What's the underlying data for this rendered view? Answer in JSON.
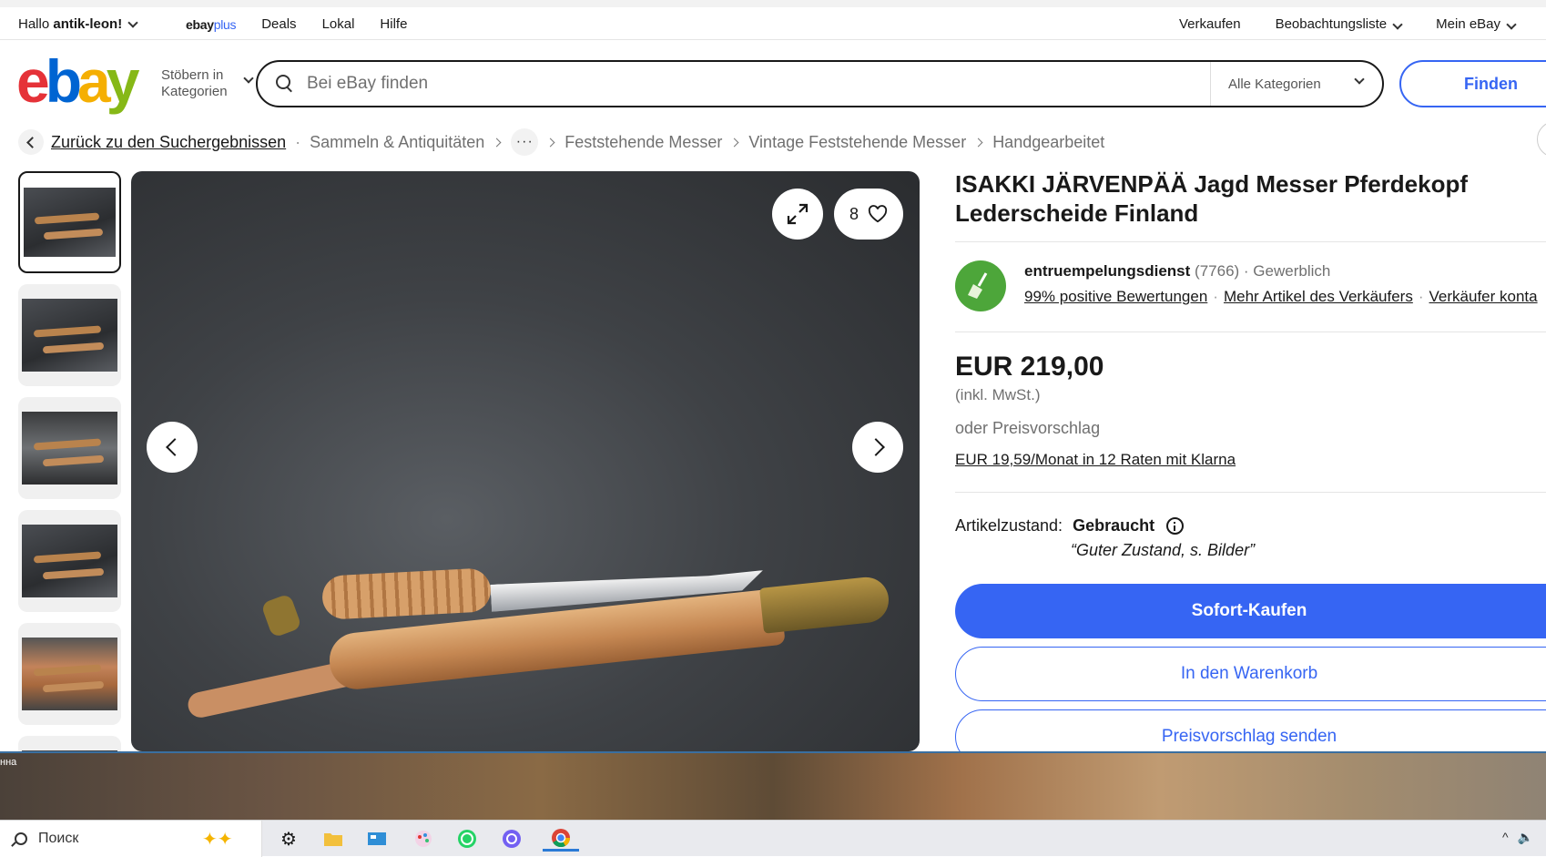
{
  "topbar": {
    "greeting": "Hallo",
    "username": "antik-leon!",
    "plus_brand": "ebay",
    "plus_suffix": "plus",
    "nav": [
      "Deals",
      "Lokal",
      "Hilfe"
    ],
    "sell": "Verkaufen",
    "watchlist": "Beobachtungsliste",
    "my_ebay": "Mein eBay"
  },
  "header": {
    "logo_letters": [
      "e",
      "b",
      "a",
      "y"
    ],
    "browse_label_1": "Stöbern in",
    "browse_label_2": "Kategorien",
    "search_placeholder": "Bei eBay finden",
    "category_select": "Alle Kategorien",
    "find_button": "Finden"
  },
  "breadcrumb": {
    "back_link": "Zurück zu den Suchergebnissen",
    "items": [
      "Sammeln & Antiquitäten",
      "Feststehende Messer",
      "Vintage Feststehende Messer",
      "Handgearbeitet"
    ],
    "more": "···"
  },
  "gallery": {
    "thumbnail_count": 6,
    "selected_index": 0,
    "watch_count": "8"
  },
  "listing": {
    "title": "ISAKKI JÄRVENPÄÄ Jagd Messer Pferdekopf Lederscheide Finland",
    "seller_name": "entruempelungsdienst",
    "seller_score": "(7766)",
    "seller_type": "· Gewerblich",
    "feedback_link": "99% positive Bewertungen",
    "more_items_link": "Mehr Artikel des Verkäufers",
    "contact_link": "Verkäufer konta",
    "price": "EUR 219,00",
    "vat": "(inkl. MwSt.)",
    "or_offer": "oder Preisvorschlag",
    "klarna": "EUR 19,59/Monat in 12 Raten mit Klarna",
    "condition_label": "Artikelzustand:",
    "condition_value": "Gebraucht",
    "condition_note": "“Guter Zustand, s. Bilder”",
    "buy_now": "Sofort-Kaufen",
    "add_to_cart": "In den Warenkorb",
    "make_offer": "Preisvorschlag senden"
  },
  "desktop": {
    "label": "нна"
  },
  "taskbar": {
    "search_placeholder": "Поиск",
    "icons": [
      "settings-icon",
      "file-explorer-icon",
      "control-panel-icon",
      "paint-icon",
      "whatsapp-icon",
      "viber-icon",
      "chrome-icon"
    ]
  },
  "colors": {
    "accent": "#3665f3",
    "logo_e": "#e53238",
    "logo_b": "#0064d2",
    "logo_a": "#f5af02",
    "logo_y": "#86b817",
    "seller_avatar": "#4da63a"
  }
}
